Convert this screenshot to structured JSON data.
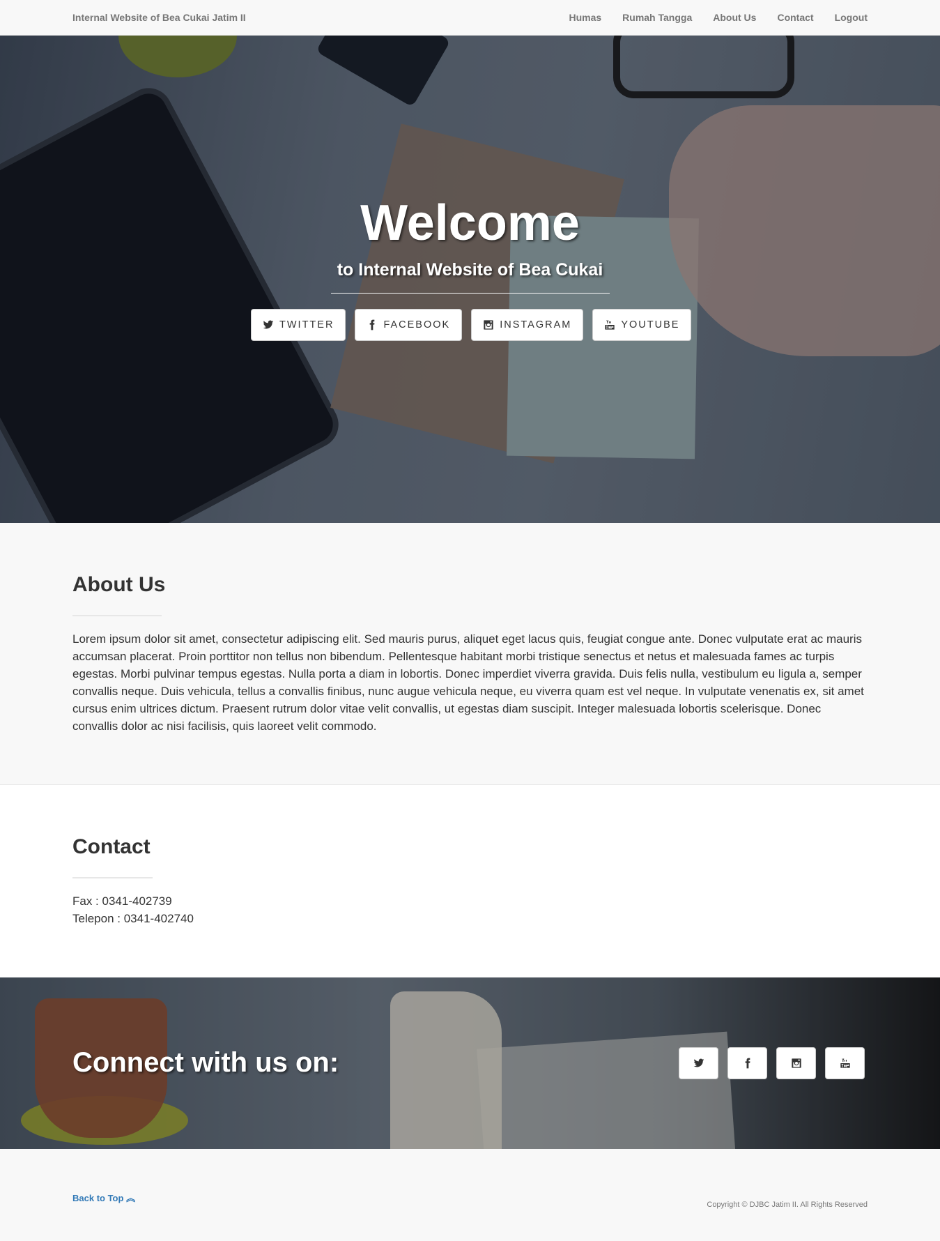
{
  "navbar": {
    "brand": "Internal Website of Bea Cukai Jatim II",
    "items": [
      {
        "label": "Humas"
      },
      {
        "label": "Rumah Tangga"
      },
      {
        "label": "About Us"
      },
      {
        "label": "Contact"
      },
      {
        "label": "Logout"
      }
    ]
  },
  "hero": {
    "title": "Welcome",
    "subtitle": "to Internal Website of Bea Cukai",
    "buttons": [
      {
        "label": "TWITTER",
        "icon": "twitter-icon"
      },
      {
        "label": "FACEBOOK",
        "icon": "facebook-icon"
      },
      {
        "label": "INSTAGRAM",
        "icon": "instagram-icon"
      },
      {
        "label": "YOUTUBE",
        "icon": "youtube-icon"
      }
    ]
  },
  "about": {
    "heading": "About Us",
    "text": "Lorem ipsum dolor sit amet, consectetur adipiscing elit. Sed mauris purus, aliquet eget lacus quis, feugiat congue ante. Donec vulputate erat ac mauris accumsan placerat. Proin porttitor non tellus non bibendum. Pellentesque habitant morbi tristique senectus et netus et malesuada fames ac turpis egestas. Morbi pulvinar tempus egestas. Nulla porta a diam in lobortis. Donec imperdiet viverra gravida. Duis felis nulla, vestibulum eu ligula a, semper convallis neque. Duis vehicula, tellus a convallis finibus, nunc augue vehicula neque, eu viverra quam est vel neque. In vulputate venenatis ex, sit amet cursus enim ultrices dictum. Praesent rutrum dolor vitae velit convallis, ut egestas diam suscipit. Integer malesuada lobortis scelerisque. Donec convallis dolor ac nisi facilisis, quis laoreet velit commodo."
  },
  "contact": {
    "heading": "Contact",
    "fax": "Fax : 0341-402739",
    "telepon": "Telepon : 0341-402740"
  },
  "banner": {
    "heading": "Connect with us on:",
    "icons": [
      "twitter-icon",
      "facebook-icon",
      "instagram-icon",
      "youtube-icon"
    ]
  },
  "footer": {
    "back_to_top": "Back to Top",
    "copyright": "Copyright © DJBC Jatim II. All Rights Reserved",
    "link_color": "#337ab7"
  }
}
